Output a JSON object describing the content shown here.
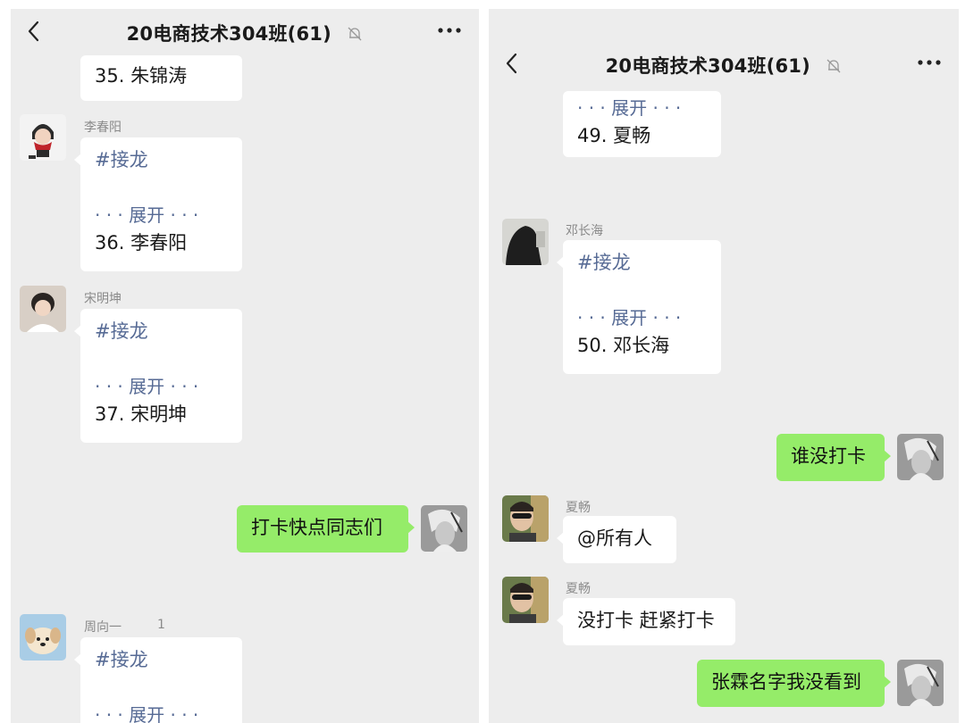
{
  "left": {
    "title": "20电商技术304班(61)",
    "messages": [
      {
        "text": "35. 朱锦涛"
      },
      {
        "sender": "李春阳",
        "avatar_icon": "anime-character-avatar",
        "tag": "#接龙",
        "expand": "· · · 展开 · · ·",
        "text": "36. 李春阳"
      },
      {
        "sender": "宋明坤",
        "avatar_icon": "person-photo-avatar",
        "tag": "#接龙",
        "expand": "· · · 展开 · · ·",
        "text": "37. 宋明坤"
      },
      {
        "self": true,
        "text": "打卡快点同志们",
        "avatar_icon": "sketch-portrait-avatar"
      },
      {
        "sender": "周向一",
        "count": "1",
        "avatar_icon": "puppy-avatar",
        "tag": "#接龙",
        "expand": "· · · 展开 · · ·"
      }
    ]
  },
  "right": {
    "title": "20电商技术304班(61)",
    "messages": [
      {
        "expand": "· · · 展开 · · ·",
        "text": "49. 夏畅"
      },
      {
        "sender": "邓长海",
        "avatar_icon": "dark-photo-avatar",
        "tag": "#接龙",
        "expand": "· · · 展开 · · ·",
        "text": "50. 邓长海"
      },
      {
        "self": true,
        "text": "谁没打卡",
        "avatar_icon": "sketch-portrait-avatar"
      },
      {
        "sender": "夏畅",
        "avatar_icon": "sunglasses-photo-avatar",
        "text": "@所有人"
      },
      {
        "sender": "夏畅",
        "avatar_icon": "sunglasses-photo-avatar",
        "text": "没打卡 赶紧打卡"
      },
      {
        "self": true,
        "text": "张霖名字我没看到",
        "avatar_icon": "sketch-portrait-avatar"
      }
    ]
  },
  "colors": {
    "background": "#ededed",
    "incoming_bubble": "#ffffff",
    "outgoing_bubble": "#95ec69",
    "link": "#576b95",
    "sender_name": "#8a8a8a"
  }
}
